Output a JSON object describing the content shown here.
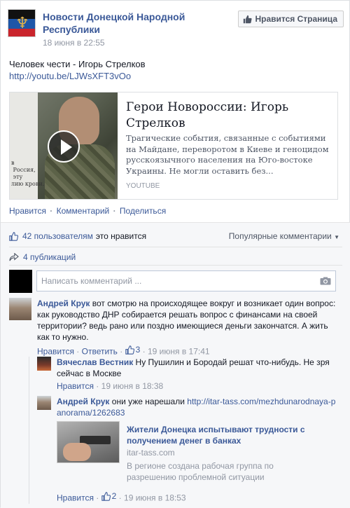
{
  "page": {
    "name": "Новости Донецкой Народной Республики",
    "time": "18 июня в 22:55",
    "like_button": "Нравится Страница"
  },
  "post": {
    "text": "Человек чести - Игорь Стрелков",
    "link": "http://youtu.be/LJWsXFT3vOo",
    "share": {
      "title": "Герои Новороссии: Игорь Стрелков",
      "description": "Трагические события, связанные с событиями на Майдане, переворотом в Киеве и геноцидом русскоязычного населения на Юго-востоке Украины. Не могли оставить без...",
      "source": "YOUTUBE",
      "thumb_text": "в\n Россия,\n эту\nлию крови."
    },
    "actions": {
      "like": "Нравится",
      "comment": "Комментарий",
      "share": "Поделиться"
    }
  },
  "ufi": {
    "likes_count": "42 пользователям",
    "likes_rest": "это нравится",
    "sort": "Популярные комментарии",
    "shares": "4 публикаций",
    "comment_placeholder": "Написать комментарий ..."
  },
  "comments": [
    {
      "author": "Андрей Крук",
      "text": "вот смотрю на происходящее вокруг и возникает один вопрос: как руководство ДНР собирается решать вопрос с финансами на своей территории? ведь рано или поздно имеющиеся деньги закончатся. А жить как то нужно.",
      "like": "Нравится",
      "reply": "Ответить",
      "likes": "3",
      "time": "19 июня в 17:41"
    },
    {
      "author": "Вячеслав Вестник",
      "text": "Ну Пушилин и Бородай решат что-нибудь. Не зря сейчас в Москве",
      "like": "Нравится",
      "time": "19 июня в 18:38"
    },
    {
      "author": "Андрей Крук",
      "text_prefix": "они уже нарешали",
      "link": "http://itar-tass.com/mezhdunarodnaya-panorama/1262683",
      "attachment": {
        "title": "Жители Донецка испытывают трудности с получением денег в банках",
        "source": "itar-tass.com",
        "description": "В регионе создана рабочая группа по разрешению проблемной ситуации"
      },
      "like": "Нравится",
      "likes": "2",
      "time": "19 июня в 18:53"
    }
  ],
  "icons": {
    "thumb": "thumbs-up-icon",
    "share": "share-arrow-icon",
    "camera": "camera-icon",
    "play": "play-icon",
    "caret": "caret-down-icon"
  },
  "colors": {
    "link": "#3b5998",
    "muted": "#9197a3"
  }
}
